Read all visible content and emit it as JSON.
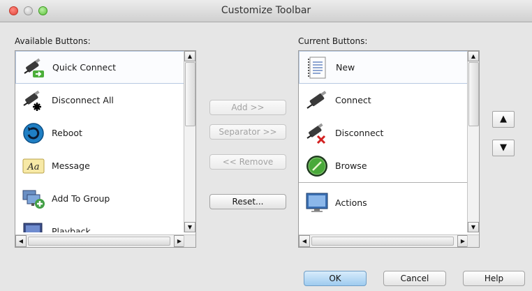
{
  "window": {
    "title": "Customize Toolbar"
  },
  "available": {
    "label": "Available Buttons:",
    "items": [
      {
        "label": "Quick Connect",
        "icon": "quick-connect-icon",
        "selected": true
      },
      {
        "label": "Disconnect All",
        "icon": "disconnect-all-icon"
      },
      {
        "label": "Reboot",
        "icon": "reboot-icon"
      },
      {
        "label": "Message",
        "icon": "message-icon"
      },
      {
        "label": "Add To Group",
        "icon": "add-to-group-icon"
      },
      {
        "label": "Playback",
        "icon": "playback-icon"
      }
    ]
  },
  "current": {
    "label": "Current Buttons:",
    "items": [
      {
        "label": "New",
        "icon": "new-document-icon",
        "selected": true
      },
      {
        "label": "Connect",
        "icon": "connect-icon"
      },
      {
        "label": "Disconnect",
        "icon": "disconnect-icon"
      },
      {
        "label": "Browse",
        "icon": "browse-icon"
      },
      {
        "label": "Actions",
        "icon": "actions-icon",
        "separator_above": true
      }
    ]
  },
  "buttons": {
    "add": "Add >>",
    "separator": "Separator >>",
    "remove": "<< Remove",
    "reset": "Reset...",
    "ok": "OK",
    "cancel": "Cancel",
    "help": "Help",
    "move_up": "▲",
    "move_down": "▼"
  },
  "scroll_glyphs": {
    "up": "▲",
    "down": "▼",
    "left": "◀",
    "right": "▶"
  }
}
